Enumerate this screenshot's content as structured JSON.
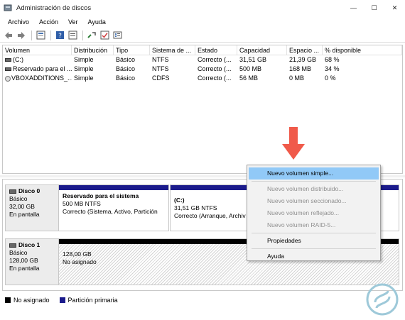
{
  "window": {
    "title": "Administración de discos",
    "controls": [
      "—",
      "☐",
      "✕"
    ]
  },
  "menu": [
    "Archivo",
    "Acción",
    "Ver",
    "Ayuda"
  ],
  "toolbar": [
    "back-icon",
    "forward-icon",
    "properties-icon",
    "help-icon",
    "refresh-icon",
    "connect-icon",
    "check-icon",
    "list-icon"
  ],
  "volumes": {
    "columns": [
      "Volumen",
      "Distribución",
      "Tipo",
      "Sistema de ...",
      "Estado",
      "Capacidad",
      "Espacio ...",
      "% disponible"
    ],
    "rows": [
      {
        "icon": "volume",
        "volumen": "(C:)",
        "distribucion": "Simple",
        "tipo": "Básico",
        "sistema": "NTFS",
        "estado": "Correcto (...",
        "capacidad": "31,51 GB",
        "espacio": "21,39 GB",
        "disponible": "68 %"
      },
      {
        "icon": "volume",
        "volumen": "Reservado para el ...",
        "distribucion": "Simple",
        "tipo": "Básico",
        "sistema": "NTFS",
        "estado": "Correcto (...",
        "capacidad": "500 MB",
        "espacio": "168 MB",
        "disponible": "34 %"
      },
      {
        "icon": "cd",
        "volumen": "VBOXADDITIONS_...",
        "distribucion": "Simple",
        "tipo": "Básico",
        "sistema": "CDFS",
        "estado": "Correcto (...",
        "capacidad": "56 MB",
        "espacio": "0 MB",
        "disponible": "0 %"
      }
    ]
  },
  "disks": [
    {
      "name": "Disco 0",
      "type": "Básico",
      "size": "32,00 GB",
      "status": "En pantalla",
      "partitions": [
        {
          "name": "Reservado para el sistema",
          "detail": "500 MB NTFS",
          "status": "Correcto (Sistema, Activo, Partición"
        },
        {
          "name": "(C:)",
          "detail": "31,51 GB NTFS",
          "status": "Correcto (Arranque, Archiv"
        }
      ]
    },
    {
      "name": "Disco 1",
      "type": "Básico",
      "size": "128,00 GB",
      "status": "En pantalla",
      "unallocated": {
        "size": "128,00 GB",
        "label": "No asignado"
      }
    }
  ],
  "legend": [
    {
      "label": "No asignado",
      "color": "#000000"
    },
    {
      "label": "Partición primaria",
      "color": "#1b1b8c"
    }
  ],
  "context_menu": {
    "items": [
      {
        "label": "Nuevo volumen simple...",
        "enabled": true,
        "highlighted": true
      },
      {
        "label": "Nuevo volumen distribuido...",
        "enabled": false
      },
      {
        "label": "Nuevo volumen seccionado...",
        "enabled": false
      },
      {
        "label": "Nuevo volumen reflejado...",
        "enabled": false
      },
      {
        "label": "Nuevo volumen RAID-5...",
        "enabled": false
      },
      {
        "label": "Propiedades",
        "enabled": true
      },
      {
        "label": "Ayuda",
        "enabled": true
      }
    ]
  },
  "colors": {
    "highlight": "#91c9f7",
    "primary_partition": "#1b1b8c",
    "arrow": "#f05a4a"
  }
}
